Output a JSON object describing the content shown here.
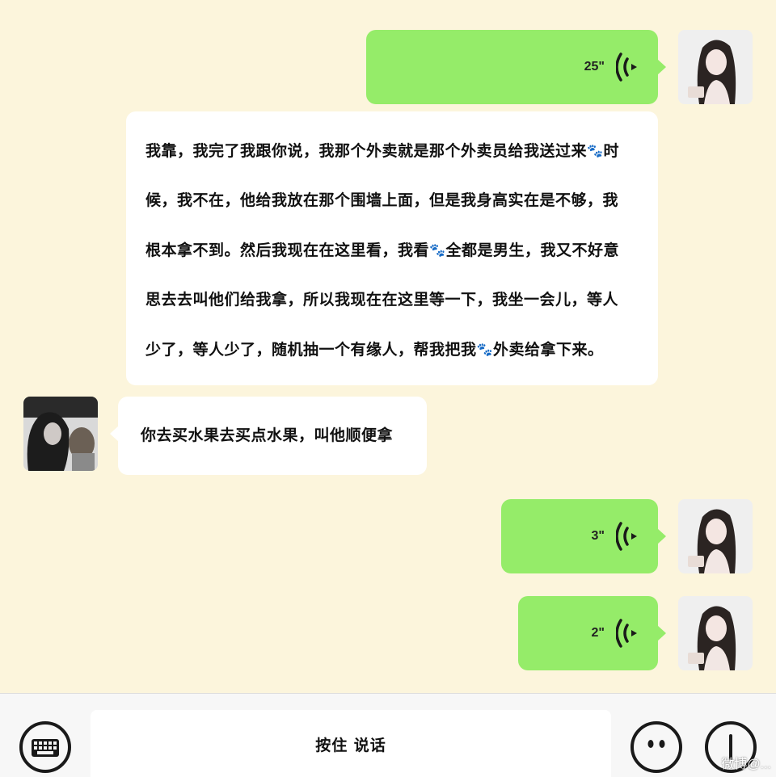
{
  "messages": {
    "m1": {
      "duration": "25\""
    },
    "m2": {
      "lines": [
        "我靠，我完了我跟你说，我那个外卖就是那个外卖员给我送过来",
        "时",
        "候，我不在，他给我放在那个围墙上面，但是我身高实在是不够，我",
        "根本拿不到。然后我现在在这里看，我看",
        "全都是男生，我又不好意",
        "思去去叫他们给我拿，所以我现在在这里等一下，我坐一会儿，等人",
        "少了，等人少了，随机抽一个有缘人，帮我把我",
        "外卖给拿下来。"
      ]
    },
    "m3": {
      "text": "你去买水果去买点水果，叫他顺便拿"
    },
    "m4": {
      "duration": "3\""
    },
    "m5": {
      "duration": "2\""
    }
  },
  "emoji": {
    "paw": "🐾"
  },
  "input_bar": {
    "hold_to_talk": "按住  说话"
  },
  "icons": [
    "keyboard-icon",
    "voice-wave-icon",
    "paw-icon",
    "emoji-icon",
    "add-icon"
  ],
  "colors": {
    "background": "#fcf5dc",
    "self_bubble": "#95ec69",
    "other_bubble": "#ffffff"
  },
  "watermark": "微博@..."
}
